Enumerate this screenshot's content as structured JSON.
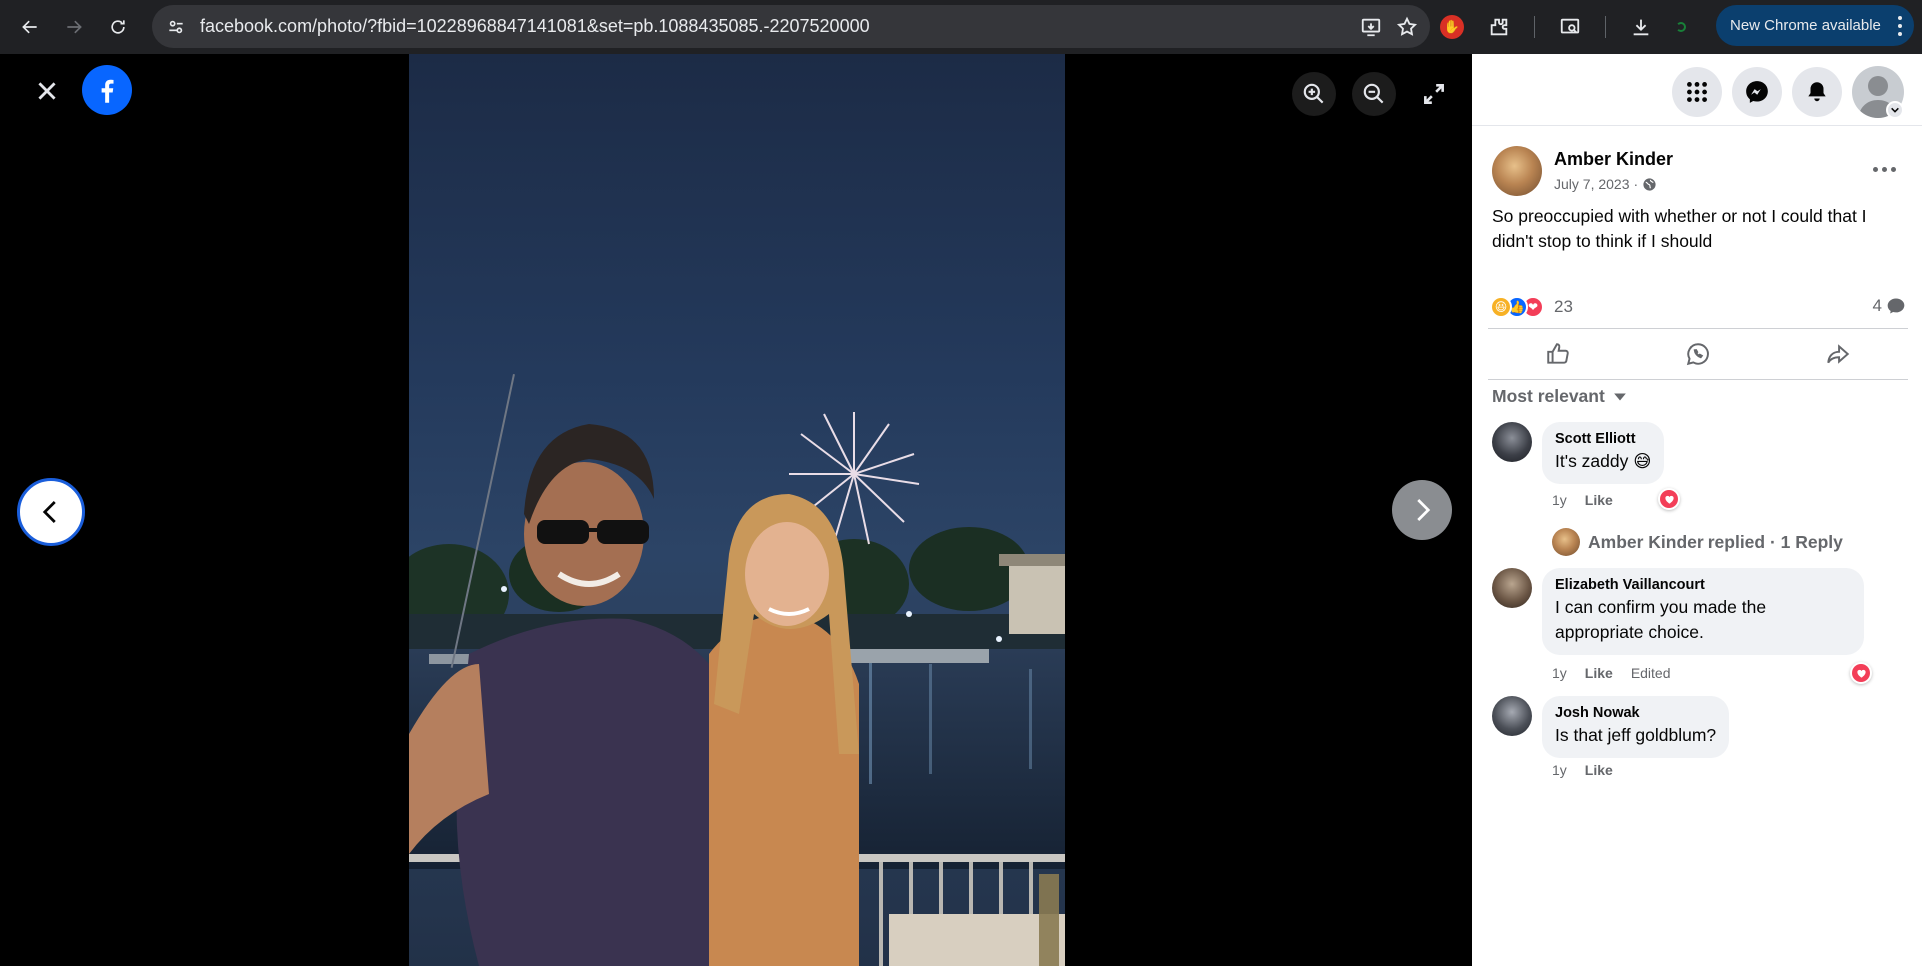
{
  "browser": {
    "url": "facebook.com/photo/?fbid=10228968847141081&set=pb.1088435085.-2207520000",
    "new_chrome_label": "New Chrome available"
  },
  "post": {
    "author": "Amber Kinder",
    "date": "July 7, 2023",
    "date_separator": "·",
    "text": "So preoccupied with whether or not I could that I didn't stop to think if I should",
    "reaction_count": "23",
    "comment_count": "4"
  },
  "comments_sort": "Most relevant",
  "comments": [
    {
      "name": "Scott Elliott",
      "text": "It's zaddy 😅",
      "time": "1y",
      "like": "Like",
      "edited": ""
    },
    {
      "name": "Elizabeth Vaillancourt",
      "text": "I can confirm you made the appropriate choice.",
      "time": "1y",
      "like": "Like",
      "edited": "Edited"
    },
    {
      "name": "Josh Nowak",
      "text": "Is that jeff goldblum?",
      "time": "1y",
      "like": "Like",
      "edited": ""
    }
  ],
  "reply_summary": {
    "author": "Amber Kinder",
    "text": "replied · 1 Reply"
  },
  "colors": {
    "facebook_blue": "#0866ff",
    "love_red": "#f33e58",
    "chrome_bg": "#202124"
  }
}
